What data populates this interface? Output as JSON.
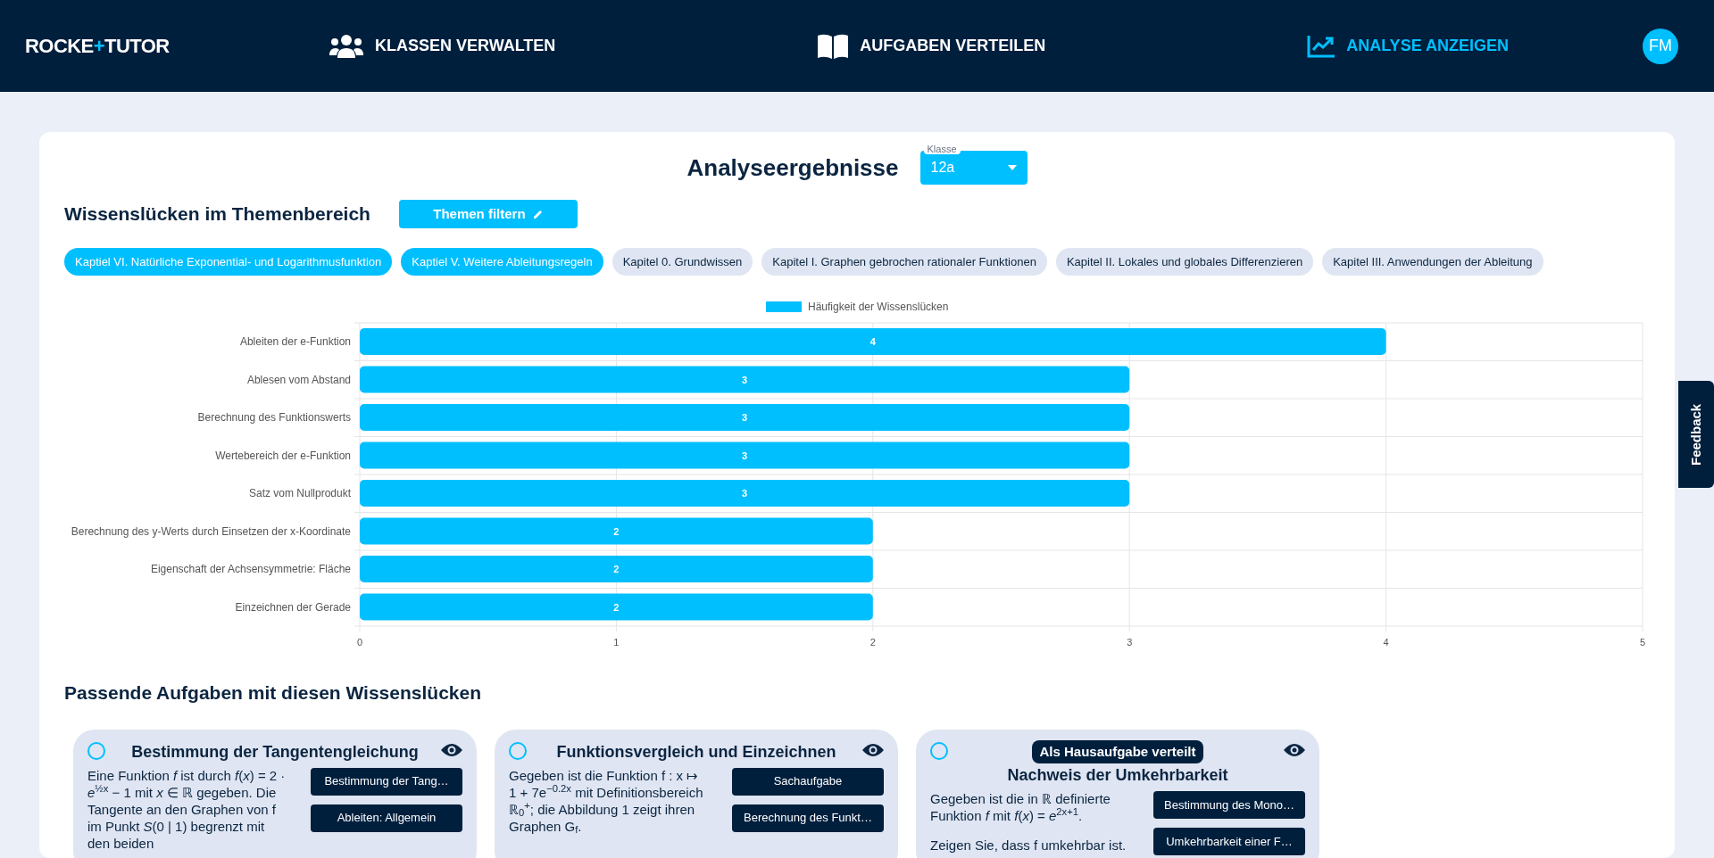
{
  "header": {
    "logo": [
      {
        "text": "ROCKE",
        "accent": false
      },
      {
        "text": "+",
        "accent": true
      },
      {
        "text": "TUTOR",
        "accent": false
      }
    ],
    "nav": [
      {
        "label": "KLASSEN VERWALTEN",
        "kind": "users",
        "selected": false
      },
      {
        "label": "AUFGABEN VERTEILEN",
        "kind": "book",
        "selected": false
      },
      {
        "label": "ANALYSE ANZEIGEN",
        "kind": "chart",
        "selected": true
      }
    ],
    "avatar": "FM"
  },
  "title": "Analyseergebnisse",
  "class_select": {
    "label": "Klasse",
    "value": "12a"
  },
  "gaps_section": {
    "title": "Wissenslücken im Themenbereich",
    "filter_button": "Themen filtern",
    "chips": [
      {
        "label": "Kaptiel VI. Natürliche Exponential- und Logarithmusfunktion",
        "selected": true
      },
      {
        "label": "Kaptiel V. Weitere Ableitungsregeln",
        "selected": true
      },
      {
        "label": "Kapitel 0. Grundwissen",
        "selected": false
      },
      {
        "label": "Kapitel I. Graphen gebrochen rationaler Funktionen",
        "selected": false
      },
      {
        "label": "Kapitel II. Lokales und globales Differenzieren",
        "selected": false
      },
      {
        "label": "Kapitel III. Anwendungen der Ableitung",
        "selected": false
      }
    ],
    "chart_data": {
      "type": "bar",
      "orientation": "horizontal",
      "categories": [
        "Ableiten der e-Funktion",
        "Ablesen vom Abstand",
        "Berechnung des Funktionswerts",
        "Wertebereich der e-Funktion",
        "Satz vom Nullprodukt",
        "Berechnung des y-Werts durch Einsetzen der x-Koordinate",
        "Eigenschaft der Achsensymmetrie: Fläche",
        "Einzeichnen der Gerade"
      ],
      "series": [
        {
          "name": "Häufigkeit der Wissenslücken",
          "color": "#00bfff",
          "values": [
            4,
            3,
            3,
            3,
            3,
            2,
            2,
            2
          ]
        }
      ],
      "xlim": [
        0,
        5
      ],
      "xticks": [
        0,
        1,
        2,
        3,
        4,
        5
      ],
      "data_labels": true,
      "grid": true
    }
  },
  "tasks_section": {
    "title": "Passende Aufgaben mit diesen Wissenslücken",
    "cards": [
      {
        "title": "Bestimmung der Tangentengleichung",
        "selected": false,
        "homework": false,
        "text": [
          "Eine Funktion *f* ist durch *f*(*x*) = 2 · *e*$^{½x}$ − 1 mit *x* ∈ ℝ gegeben. Die Tangente an den Graphen von f im Punkt *S*(0 | 1) begrenzt mit den beiden"
        ],
        "tags": [
          "Bestimmung der Tang…",
          "Ableiten: Allgemein"
        ]
      },
      {
        "title": "Funktionsvergleich und Einzeichnen",
        "selected": false,
        "homework": false,
        "text": [
          "Gegeben ist die Funktion f : x ↦ 1 + 7e$^{−0.2x}$ mit Definitionsbereich ℝ$_{0}$$^{+}$; die Abbildung 1 zeigt ihren Graphen G$_{f}$."
        ],
        "tags": [
          "Sachaufgabe",
          "Berechnung des Funkt…"
        ]
      },
      {
        "title": "Nachweis der Umkehrbarkeit",
        "selected": false,
        "homework": true,
        "badge": "Als Hausaufgabe verteilt",
        "text": [
          "Gegeben ist die in ℝ definierte Funktion *f* mit *f*(*x*) = *e*$^{2x+1}$.",
          "Zeigen Sie, dass f umkehrbar ist."
        ],
        "tags": [
          "Bestimmung des Mono…",
          "Umkehrbarkeit einer F…"
        ]
      }
    ]
  },
  "feedback_tab": "Feedback"
}
